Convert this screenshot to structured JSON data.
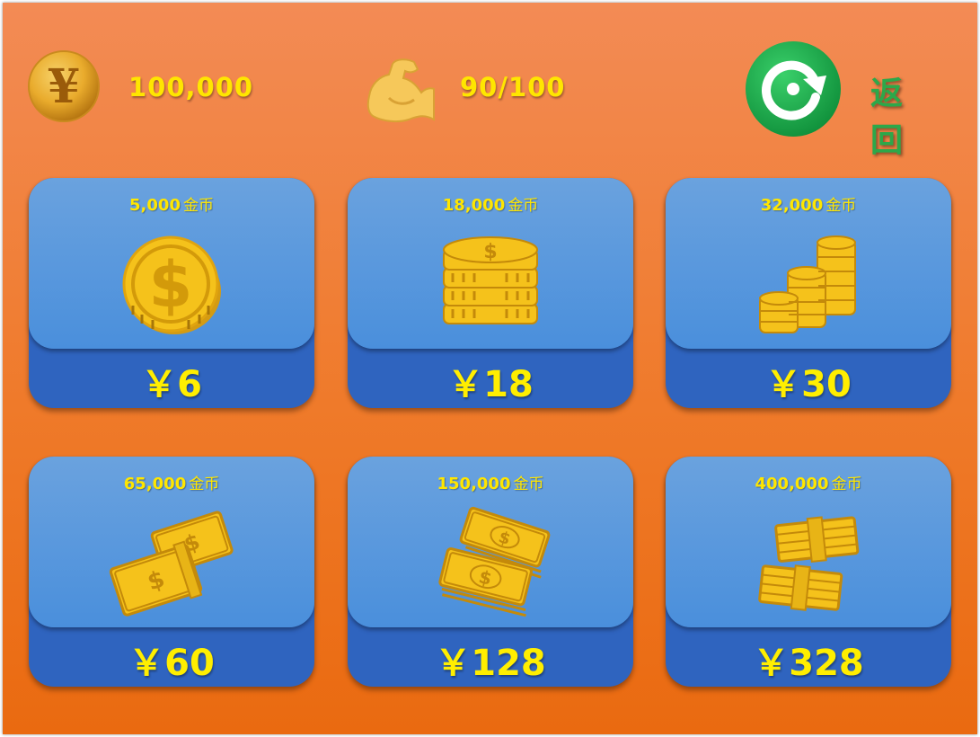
{
  "hud": {
    "coins_value": "100,000",
    "energy_value": "90/100",
    "back_label": "返回",
    "icons": {
      "coin": "yen-coin-icon",
      "energy": "flexed-arm-icon",
      "back": "refresh-return-icon"
    }
  },
  "colors": {
    "background": "#ef7a2a",
    "card_top": "#5a98e0",
    "card_bottom": "#2f64bf",
    "gold": "#ffe600",
    "back_green": "#2ca84a"
  },
  "packs": [
    {
      "amount": "5,000",
      "unit": "金币",
      "price": "￥6",
      "icon": "single-dollar-coin-icon"
    },
    {
      "amount": "18,000",
      "unit": "金币",
      "price": "￥18",
      "icon": "coin-stack-icon"
    },
    {
      "amount": "32,000",
      "unit": "金币",
      "price": "￥30",
      "icon": "coin-stacks-icon"
    },
    {
      "amount": "65,000",
      "unit": "金币",
      "price": "￥60",
      "icon": "cash-bundles-icon"
    },
    {
      "amount": "150,000",
      "unit": "金币",
      "price": "￥128",
      "icon": "cash-pile-icon"
    },
    {
      "amount": "400,000",
      "unit": "金币",
      "price": "￥328",
      "icon": "cash-bricks-icon"
    }
  ]
}
